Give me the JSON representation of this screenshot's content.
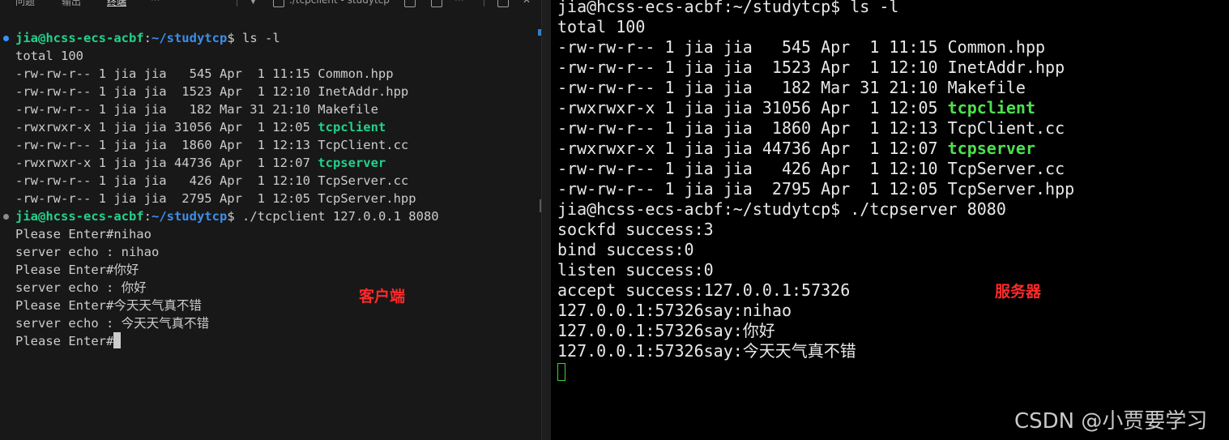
{
  "left_panel": {
    "tabs": [
      "问题",
      "输出",
      "终端"
    ],
    "active_tab": "终端",
    "more": "···",
    "terminal_title": "./tcpclient - studytcp",
    "lines": [
      {
        "type": "prompt",
        "user": "jia@hcss-ecs-acbf",
        "sep": ":",
        "path": "~/studytcp",
        "sym": "$",
        "cmd": " ls -l",
        "dot": "blue"
      },
      {
        "type": "text",
        "text": "total 100"
      },
      {
        "type": "file",
        "prefix": "-rw-rw-r-- 1 jia jia   545 Apr  1 11:15 ",
        "name": "Common.hpp",
        "exe": false
      },
      {
        "type": "file",
        "prefix": "-rw-rw-r-- 1 jia jia  1523 Apr  1 12:10 ",
        "name": "InetAddr.hpp",
        "exe": false
      },
      {
        "type": "file",
        "prefix": "-rw-rw-r-- 1 jia jia   182 Mar 31 21:10 ",
        "name": "Makefile",
        "exe": false
      },
      {
        "type": "file",
        "prefix": "-rwxrwxr-x 1 jia jia 31056 Apr  1 12:05 ",
        "name": "tcpclient",
        "exe": true
      },
      {
        "type": "file",
        "prefix": "-rw-rw-r-- 1 jia jia  1860 Apr  1 12:13 ",
        "name": "TcpClient.cc",
        "exe": false
      },
      {
        "type": "file",
        "prefix": "-rwxrwxr-x 1 jia jia 44736 Apr  1 12:07 ",
        "name": "tcpserver",
        "exe": true
      },
      {
        "type": "file",
        "prefix": "-rw-rw-r-- 1 jia jia   426 Apr  1 12:10 ",
        "name": "TcpServer.cc",
        "exe": false
      },
      {
        "type": "file",
        "prefix": "-rw-rw-r-- 1 jia jia  2795 Apr  1 12:05 ",
        "name": "TcpServer.hpp",
        "exe": false
      },
      {
        "type": "prompt",
        "user": "jia@hcss-ecs-acbf",
        "sep": ":",
        "path": "~/studytcp",
        "sym": "$",
        "cmd": " ./tcpclient 127.0.0.1 8080",
        "dot": "grey"
      },
      {
        "type": "text",
        "text": "Please Enter#nihao"
      },
      {
        "type": "text",
        "text": "server echo : nihao"
      },
      {
        "type": "text",
        "text": "Please Enter#你好"
      },
      {
        "type": "text",
        "text": "server echo : 你好"
      },
      {
        "type": "text",
        "text": "Please Enter#今天天气真不错"
      },
      {
        "type": "text",
        "text": "server echo : 今天天气真不错"
      },
      {
        "type": "cursor",
        "text": "Please Enter#"
      }
    ]
  },
  "right_panel": {
    "lines": [
      {
        "type": "text",
        "text": "jia@hcss-ecs-acbf:~/studytcp$ ls -l"
      },
      {
        "type": "text",
        "text": "total 100"
      },
      {
        "type": "file",
        "prefix": "-rw-rw-r-- 1 jia jia   545 Apr  1 11:15 ",
        "name": "Common.hpp",
        "exe": false
      },
      {
        "type": "file",
        "prefix": "-rw-rw-r-- 1 jia jia  1523 Apr  1 12:10 ",
        "name": "InetAddr.hpp",
        "exe": false
      },
      {
        "type": "file",
        "prefix": "-rw-rw-r-- 1 jia jia   182 Mar 31 21:10 ",
        "name": "Makefile",
        "exe": false
      },
      {
        "type": "file",
        "prefix": "-rwxrwxr-x 1 jia jia 31056 Apr  1 12:05 ",
        "name": "tcpclient",
        "exe": true
      },
      {
        "type": "file",
        "prefix": "-rw-rw-r-- 1 jia jia  1860 Apr  1 12:13 ",
        "name": "TcpClient.cc",
        "exe": false
      },
      {
        "type": "file",
        "prefix": "-rwxrwxr-x 1 jia jia 44736 Apr  1 12:07 ",
        "name": "tcpserver",
        "exe": true
      },
      {
        "type": "file",
        "prefix": "-rw-rw-r-- 1 jia jia   426 Apr  1 12:10 ",
        "name": "TcpServer.cc",
        "exe": false
      },
      {
        "type": "file",
        "prefix": "-rw-rw-r-- 1 jia jia  2795 Apr  1 12:05 ",
        "name": "TcpServer.hpp",
        "exe": false
      },
      {
        "type": "text",
        "text": "jia@hcss-ecs-acbf:~/studytcp$ ./tcpserver 8080"
      },
      {
        "type": "text",
        "text": "sockfd success:3"
      },
      {
        "type": "text",
        "text": "bind success:0"
      },
      {
        "type": "text",
        "text": "listen success:0"
      },
      {
        "type": "text",
        "text": "accept success:127.0.0.1:57326"
      },
      {
        "type": "text",
        "text": "127.0.0.1:57326say:nihao"
      },
      {
        "type": "text",
        "text": "127.0.0.1:57326say:你好"
      },
      {
        "type": "text",
        "text": "127.0.0.1:57326say:今天天气真不错"
      },
      {
        "type": "cursor",
        "text": ""
      }
    ]
  },
  "annotations": {
    "client": "客户端",
    "server": "服务器"
  },
  "watermark": "CSDN @小贾要学习",
  "colors": {
    "executable_left": "#23d18b",
    "executable_right": "#4ee04e",
    "annotation": "#ff2a2a",
    "prompt_path": "#3b8eea"
  }
}
